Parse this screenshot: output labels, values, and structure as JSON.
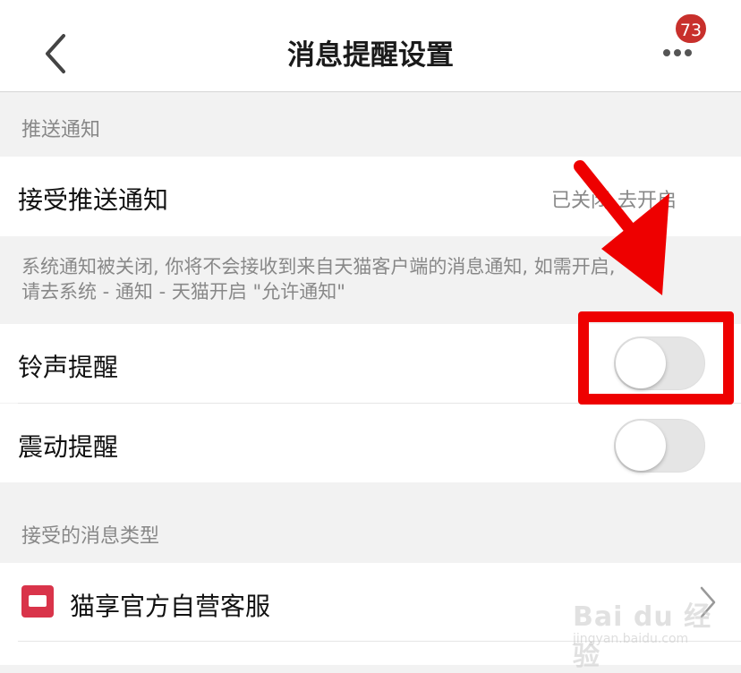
{
  "header": {
    "title": "消息提醒设置",
    "notification_count": "73",
    "back_icon": "chevron-left-icon",
    "more_icon": "more-horizontal-icon"
  },
  "push_section": {
    "header": "推送通知",
    "receive_push": {
      "label": "接受推送通知",
      "status": "已关闭",
      "action": "去开启"
    },
    "info_line1": "系统通知被关闭, 你将不会接收到来自天猫客户端的消息通知, 如需开启,",
    "info_line2": "请去系统 - 通知 - 天猫开启 \"允许通知\""
  },
  "settings": [
    {
      "label": "铃声提醒",
      "enabled": false
    },
    {
      "label": "震动提醒",
      "enabled": false
    }
  ],
  "message_types_section": {
    "header": "接受的消息类型",
    "items": [
      {
        "label": "猫享官方自营客服",
        "icon": "store-icon"
      }
    ]
  },
  "annotation": {
    "color": "#ee0000"
  },
  "watermark": {
    "main": "Bai du 经验",
    "sub": "jingyan.baidu.com"
  },
  "colors": {
    "accent": "#c8302c",
    "service_icon": "#d9344a",
    "toggle_off": "#e5e5e5"
  }
}
